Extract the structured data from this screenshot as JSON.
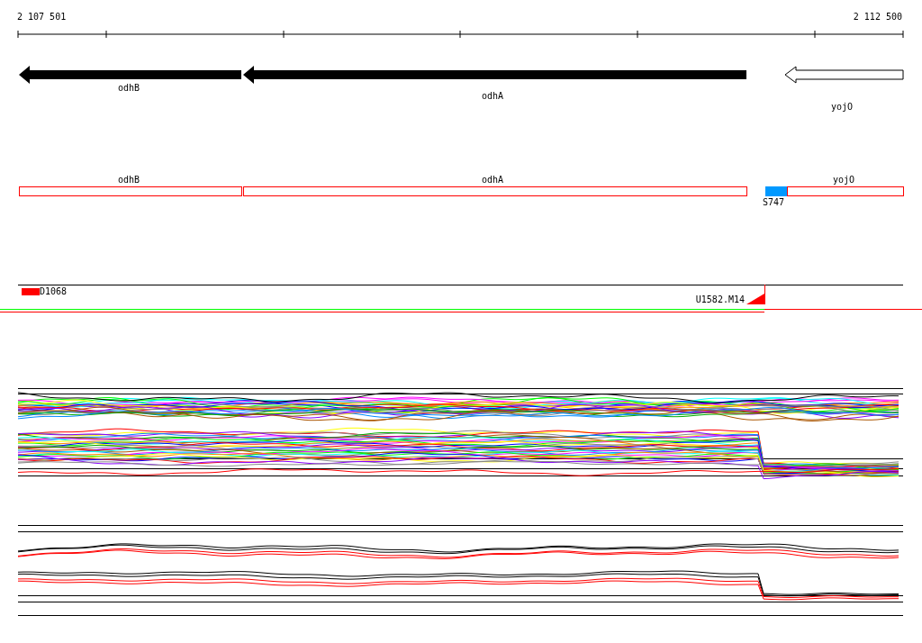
{
  "ruler": {
    "start_label": "2 107 501",
    "end_label": "2 112 500"
  },
  "genes": [
    {
      "name": "odhB",
      "filled": true
    },
    {
      "name": "odhA",
      "filled": true
    },
    {
      "name": "yojO",
      "filled": false
    }
  ],
  "annotations": [
    {
      "name": "odhB",
      "color": "#ff0000"
    },
    {
      "name": "odhA",
      "color": "#ff0000"
    },
    {
      "name": "yojO",
      "color": "#ff0000"
    }
  ],
  "sites": [
    {
      "label": "S747",
      "color": "#0099ff"
    }
  ],
  "segments": [
    {
      "label": "D1068",
      "kind": "block",
      "color": "#ff0000"
    },
    {
      "label": "U1582.M14",
      "kind": "ramp",
      "color": "#ff0000"
    }
  ]
}
